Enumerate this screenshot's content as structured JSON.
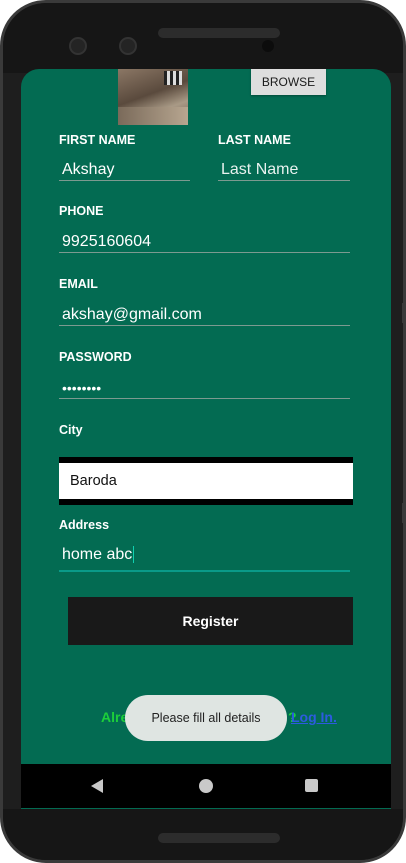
{
  "form": {
    "browse_label": "BROWSE",
    "first_name_label": "FIRST NAME",
    "first_name_value": "Akshay",
    "last_name_label": "LAST NAME",
    "last_name_placeholder": "Last Name",
    "phone_label": "PHONE",
    "phone_value": "9925160604",
    "email_label": "EMAIL",
    "email_value": "akshay@gmail.com",
    "password_label": "PASSWORD",
    "password_value": "••••••••",
    "city_label": "City",
    "city_value": "Baroda",
    "address_label": "Address",
    "address_value": "home abc",
    "register_label": "Register"
  },
  "footer": {
    "already_text": "Alrea",
    "already_tail": "?",
    "login_label": "Log In."
  },
  "toast": {
    "message": "Please fill all details"
  },
  "colors": {
    "screen_bg": "#036b52",
    "register_bg": "#191919",
    "already_text": "#1ccf3a",
    "login_link": "#2d5be0"
  },
  "nav": {
    "back_icon": "back-triangle-icon",
    "home_icon": "home-circle-icon",
    "recents_icon": "recents-square-icon"
  }
}
